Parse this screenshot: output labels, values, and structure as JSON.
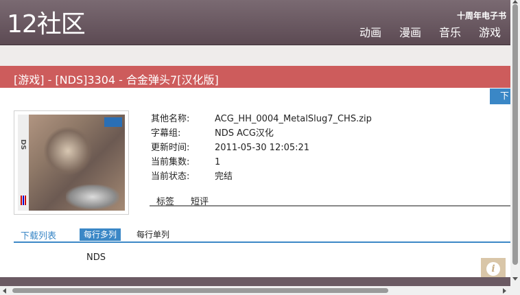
{
  "header": {
    "logo": "12社区",
    "subtitle": "十周年电子书",
    "nav": [
      "动画",
      "漫画",
      "音乐",
      "游戏"
    ]
  },
  "page": {
    "title": "[游戏] - [NDS]3304 - 合金弹头7[汉化版]",
    "download_tab": "下"
  },
  "details": [
    {
      "key": "其他名称:",
      "value": "ACG_HH_0004_MetalSlug7_CHS.zip"
    },
    {
      "key": "字幕组:",
      "value": "NDS ACG汉化"
    },
    {
      "key": "更新时间:",
      "value": "2011-05-30 12:05:21"
    },
    {
      "key": "当前集数:",
      "value": "1"
    },
    {
      "key": "当前状态:",
      "value": "完结"
    }
  ],
  "subtabs": [
    "标签",
    "短评"
  ],
  "download_list": {
    "title": "下载列表",
    "modes": [
      "每行多列",
      "每行单列"
    ],
    "active_mode": "每行多列",
    "items": [
      "NDS"
    ]
  },
  "info_button": "i",
  "colors": {
    "header": "#6b5a63",
    "title_bar": "#cd5c5c",
    "accent": "#3a87c6",
    "info_button": "#d9c6a8"
  }
}
